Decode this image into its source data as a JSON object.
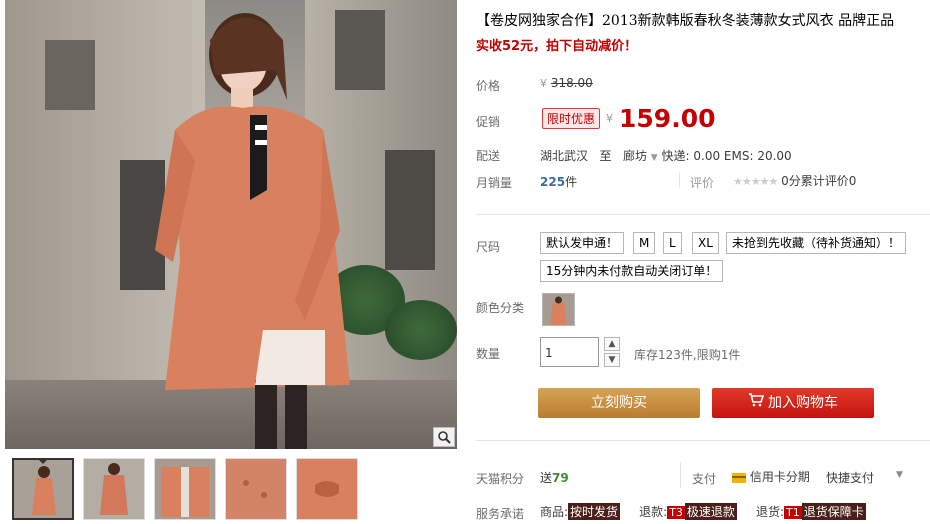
{
  "product": {
    "title": "【卷皮网独家合作】2013新款韩版春秋冬装薄款女式风衣 品牌正品",
    "subtitle": "实收52元，拍下自动减价！"
  },
  "price": {
    "label": "价格",
    "currency": "¥",
    "original": "318.00"
  },
  "promo": {
    "label": "促销",
    "badge": "限时优惠",
    "currency": "¥",
    "price": "159.00"
  },
  "shipping": {
    "label": "配送",
    "from": "湖北武汉",
    "to_word": "至",
    "destination": "廊坊",
    "fees": "快递: 0.00 EMS: 20.00"
  },
  "sales": {
    "label": "月销量",
    "count": "225",
    "unit": "件",
    "review_label": "评价",
    "review_text": "0分累计评价0"
  },
  "size": {
    "label": "尺码",
    "options": [
      "默认发申通！",
      "M",
      "L",
      "XL",
      "未抢到先收藏（待补货通知）！",
      "15分钟内未付款自动关闭订单！"
    ]
  },
  "color": {
    "label": "颜色分类"
  },
  "quantity": {
    "label": "数量",
    "value": "1",
    "stock": "库存123件,限购1件"
  },
  "actions": {
    "buy": "立刻购买",
    "cart": "加入购物车"
  },
  "points": {
    "label": "天猫积分",
    "prefix": "送",
    "value": "79",
    "pay_label": "支付",
    "credit": "信用卡分期",
    "quick": "快捷支付"
  },
  "service": {
    "label": "服务承诺",
    "goods": "商品:",
    "goods_tag": "按时发货",
    "refund": "退款:",
    "refund_tag_t": "T3",
    "refund_tag": "极速退款",
    "return": "退货:",
    "return_tag_t": "T1",
    "return_tag": "退货保障卡"
  },
  "colors": {
    "accent_red": "#c40000",
    "buy_brown": "#c48a3e",
    "cart_red": "#d22015",
    "review_blue": "#3c6e9c"
  }
}
